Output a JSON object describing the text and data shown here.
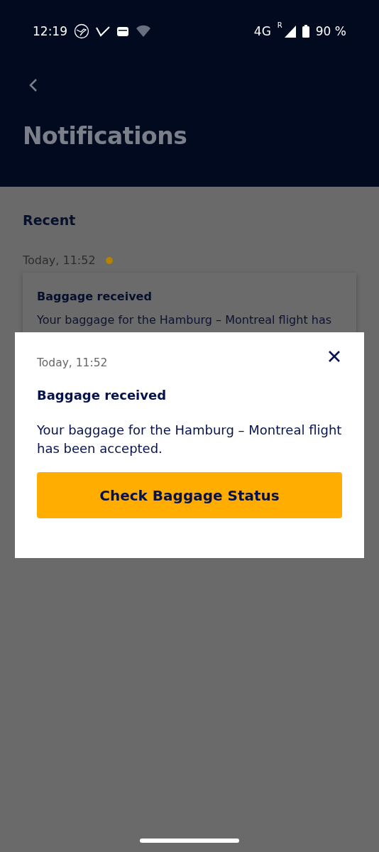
{
  "status_bar": {
    "time": "12:19",
    "network": "4G",
    "roaming": "R",
    "battery": "90 %"
  },
  "header": {
    "title": "Notifications"
  },
  "section": {
    "title": "Recent"
  },
  "notifications": [
    {
      "time": "Today, 11:52",
      "unread": true,
      "title": "Baggage received",
      "text": "Your baggage for the Hamburg – Montreal flight has"
    }
  ],
  "dialog": {
    "time": "Today, 11:52",
    "title": "Baggage received",
    "text": "Your baggage for the Hamburg – Montreal flight has been accepted.",
    "button": "Check Baggage Status"
  }
}
